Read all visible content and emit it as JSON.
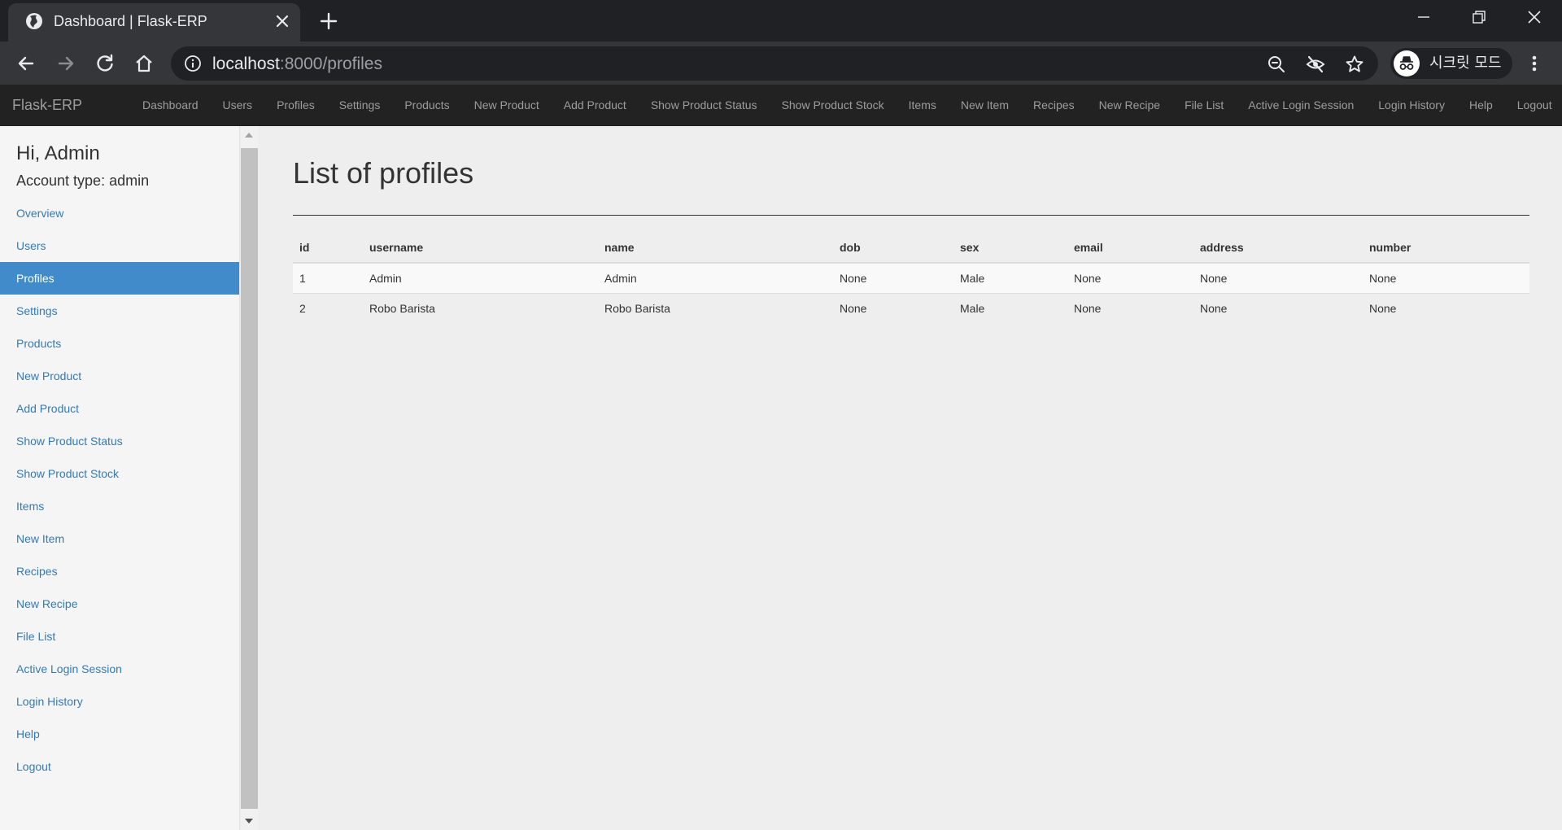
{
  "browser": {
    "tab_title": "Dashboard | Flask-ERP",
    "url_host": "localhost",
    "url_rest": ":8000/profiles",
    "incognito_label": "시크릿 모드",
    "icons": [
      "globe-icon",
      "close-icon",
      "plus-icon",
      "minimize-icon",
      "restore-icon",
      "window-close-icon",
      "back-icon",
      "forward-icon",
      "reload-icon",
      "home-icon",
      "info-icon",
      "zoom-out-icon",
      "eye-off-icon",
      "star-icon",
      "incognito-icon",
      "more-vert-icon"
    ]
  },
  "navbar": {
    "brand": "Flask-ERP",
    "links": [
      "Dashboard",
      "Users",
      "Profiles",
      "Settings",
      "Products",
      "New Product",
      "Add Product",
      "Show Product Status",
      "Show Product Stock",
      "Items",
      "New Item",
      "Recipes",
      "New Recipe",
      "File List",
      "Active Login Session",
      "Login History",
      "Help",
      "Logout"
    ]
  },
  "sidebar": {
    "greeting": "Hi, Admin",
    "account_type": "Account type: admin",
    "items": [
      "Overview",
      "Users",
      "Profiles",
      "Settings",
      "Products",
      "New Product",
      "Add Product",
      "Show Product Status",
      "Show Product Stock",
      "Items",
      "New Item",
      "Recipes",
      "New Recipe",
      "File List",
      "Active Login Session",
      "Login History",
      "Help",
      "Logout"
    ],
    "active_item": "Profiles"
  },
  "main": {
    "title": "List of profiles",
    "table": {
      "columns": [
        "id",
        "username",
        "name",
        "dob",
        "sex",
        "email",
        "address",
        "number"
      ],
      "rows": [
        [
          "1",
          "Admin",
          "Admin",
          "None",
          "Male",
          "None",
          "None",
          "None"
        ],
        [
          "2",
          "Robo Barista",
          "Robo Barista",
          "None",
          "Male",
          "None",
          "None",
          "None"
        ]
      ]
    }
  },
  "colors": {
    "navbar_bg": "#222222",
    "sidebar_active": "#428bca",
    "link": "#337ab7"
  }
}
